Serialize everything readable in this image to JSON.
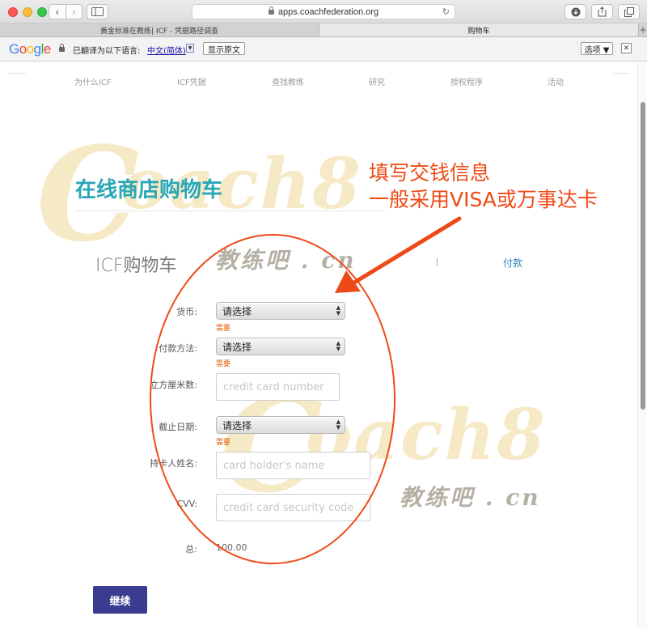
{
  "browser": {
    "url": "apps.coachfederation.org",
    "tabs": [
      {
        "label": "黃金标准在教练| ICF - 凭据路径调查",
        "active": false
      },
      {
        "label": "购物车",
        "active": true
      }
    ],
    "new_tab_label": "+"
  },
  "translate_bar": {
    "logo": "Google",
    "message": "已翻译为以下语言:",
    "language": "中文(简体)",
    "show_original": "显示原文",
    "options": "选项 ▼",
    "close": "✕"
  },
  "site_nav": [
    "为什么ICF",
    "ICF凭据",
    "查找教练",
    "研究",
    "授权程序",
    "活动"
  ],
  "page": {
    "title": "在线商店购物车",
    "cart_heading": "ICF购物车",
    "step_pay": "付款"
  },
  "annotation": {
    "line1": "填写交钱信息",
    "line2": "一般采用VISA或万事达卡",
    "color": "#ee4a17"
  },
  "watermark": {
    "brand": "oach8",
    "brand_initial": "C",
    "sub": "教练吧 . cn"
  },
  "form": {
    "currency": {
      "label": "货币:",
      "value": "请选择",
      "required": "需要"
    },
    "payment_method": {
      "label": "付款方法:",
      "value": "请选择",
      "required": "需要"
    },
    "card_number": {
      "label": "立方厘米数:",
      "placeholder": "credit card number"
    },
    "expiry": {
      "label": "截止日期:",
      "value": "请选择",
      "required": "需要"
    },
    "holder": {
      "label": "持卡人姓名:",
      "placeholder": "card holder's name"
    },
    "cvv": {
      "label": "CVV:",
      "placeholder": "credit card security code"
    },
    "total": {
      "label": "总:",
      "value": "100.00"
    }
  },
  "continue_button": "继续",
  "colors": {
    "accent": "#2aa7b6",
    "button": "#3a3d8f",
    "required": "#e06010",
    "link": "#2a7fb8"
  }
}
